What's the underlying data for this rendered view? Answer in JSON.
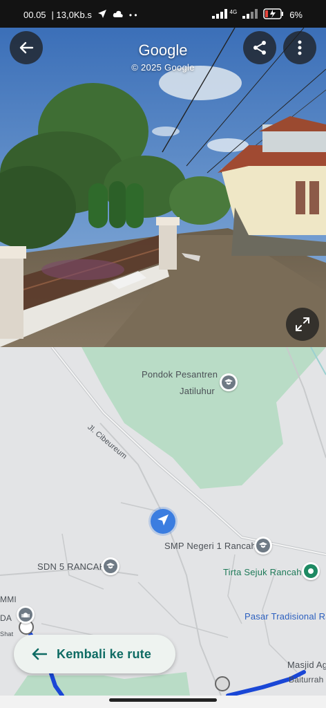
{
  "status_bar": {
    "time": "00.05",
    "speed": "| 13,0Kb.s",
    "network_label": "4G",
    "battery_percent": "6%"
  },
  "street_view": {
    "title": "Google",
    "copyright": "© 2025 Google",
    "buttons": {
      "back": "arrow-back-icon",
      "share": "share-icon",
      "more": "more-vert-icon",
      "expand": "expand-icon"
    }
  },
  "map": {
    "labels": {
      "pondok_line1": "Pondok Pesantren",
      "pondok_line2": "Jatiluhur",
      "road": "Jl. Cibeureum",
      "smp": "SMP Negeri 1 Rancah",
      "sdn": "SDN 5 RANCAH",
      "tirta": "Tirta Sejuk Rancah",
      "pasar": "Pasar Tradisional Ra",
      "masjid": "Masjid Ag",
      "baiturrahman": "Baiturrah",
      "mmi": "MMI",
      "da": "DA",
      "hat": "Shat"
    },
    "colors": {
      "park": "#b9dcc6",
      "route": "#1a47d6",
      "tirta_pin": "#1e8a63"
    }
  },
  "back_to_route": {
    "label": "Kembali ke rute"
  }
}
